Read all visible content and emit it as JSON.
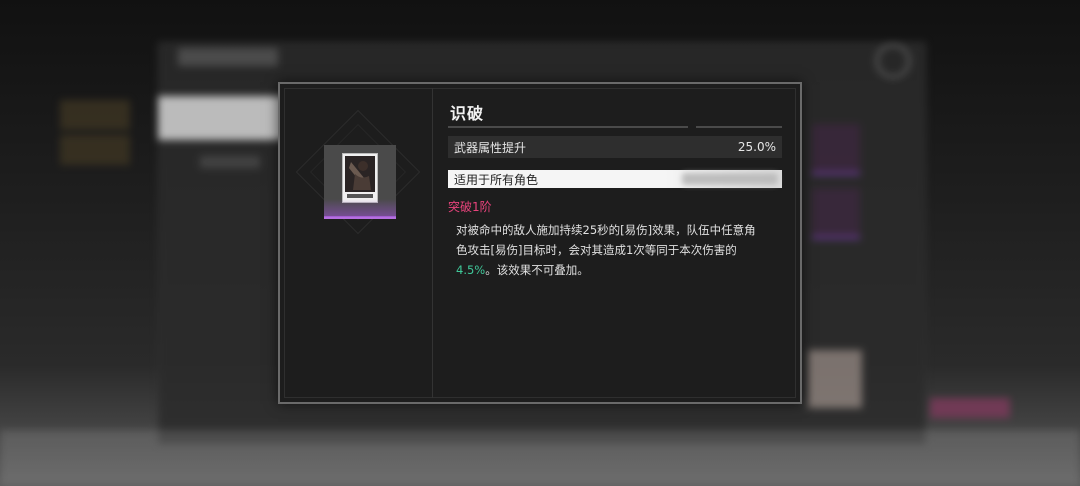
{
  "dialog": {
    "weapon_name": "识破",
    "stat": {
      "label": "武器属性提升",
      "value": "25.0%"
    },
    "applies_to": "适用于所有角色",
    "refine_level": "突破1阶",
    "description": {
      "line1": "对被命中的敌人施加持续25秒的[易伤]效果，队伍中任意角",
      "line2": "色攻击[易伤]目标时，会对其造成1次等同于本次伤害的",
      "highlight": "4.5%",
      "line3_rest": "。该效果不可叠加。"
    }
  },
  "colors": {
    "refine_accent": "#e8437c",
    "highlight_value": "#3fc99a",
    "rarity_purple": "#b56fe0"
  },
  "icons": {
    "weapon_card": "weapon-card-art",
    "background_close": "close-icon"
  }
}
